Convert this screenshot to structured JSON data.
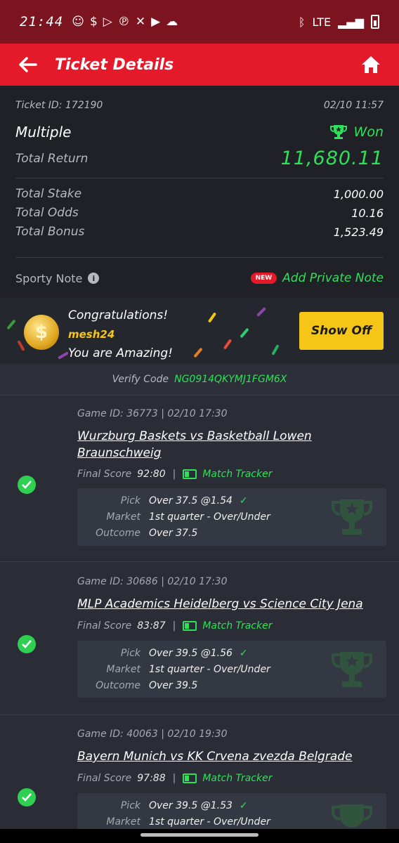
{
  "status_bar": {
    "time": "21:44",
    "network": "LTE"
  },
  "header": {
    "title": "Ticket Details"
  },
  "ticket": {
    "id_label": "Ticket ID: 172190",
    "datetime": "02/10 11:57",
    "type": "Multiple",
    "status": "Won",
    "total_return_label": "Total Return",
    "total_return": "11,680.11",
    "total_stake_label": "Total Stake",
    "total_stake": "1,000.00",
    "total_odds_label": "Total Odds",
    "total_odds": "10.16",
    "total_bonus_label": "Total Bonus",
    "total_bonus": "1,523.49"
  },
  "note": {
    "label": "Sporty Note",
    "new_badge": "NEW",
    "add_label": "Add Private Note"
  },
  "banner": {
    "line1": "Congratulations!",
    "username": "mesh24",
    "line3": "You are Amazing!",
    "button": "Show Off"
  },
  "verify": {
    "label": "Verify Code",
    "code": "NG0914QKYMJ1FGM6X"
  },
  "labels": {
    "final_score": "Final Score",
    "match_tracker": "Match Tracker",
    "pick": "Pick",
    "market": "Market",
    "outcome": "Outcome"
  },
  "bets": [
    {
      "game": "Game ID: 36773 | 02/10 17:30",
      "match": "Wurzburg Baskets vs Basketball Lowen Braunschweig",
      "score": "92:80",
      "pick": "Over 37.5 @1.54",
      "market": "1st quarter - Over/Under",
      "outcome": "Over 37.5"
    },
    {
      "game": "Game ID: 30686 | 02/10 17:30",
      "match": "MLP Academics Heidelberg vs Science City Jena",
      "score": "83:87",
      "pick": "Over 39.5 @1.56",
      "market": "1st quarter - Over/Under",
      "outcome": "Over 39.5"
    },
    {
      "game": "Game ID: 40063 | 02/10 19:30",
      "match": "Bayern Munich vs KK Crvena zvezda Belgrade",
      "score": "97:88",
      "pick": "Over 39.5 @1.53",
      "market": "1st quarter - Over/Under",
      "outcome": ""
    }
  ],
  "colors": {
    "accent_red": "#e41a2a",
    "win_green": "#2fe05a",
    "button_yellow": "#f5c518"
  }
}
